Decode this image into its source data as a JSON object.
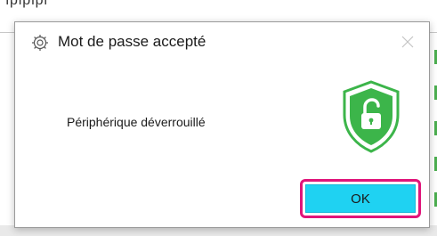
{
  "background": {
    "partial_text": "ıpıpıpı"
  },
  "dialog": {
    "title": "Mot de passe accepté",
    "message": "Périphérique déverrouillé",
    "ok_label": "OK",
    "icons": {
      "app": "gear-icon",
      "close": "close-icon",
      "status": "unlocked-shield-icon"
    },
    "colors": {
      "shield": "#3cb54a",
      "ok_button": "#1fd2f2",
      "highlight": "#e0157a"
    }
  }
}
